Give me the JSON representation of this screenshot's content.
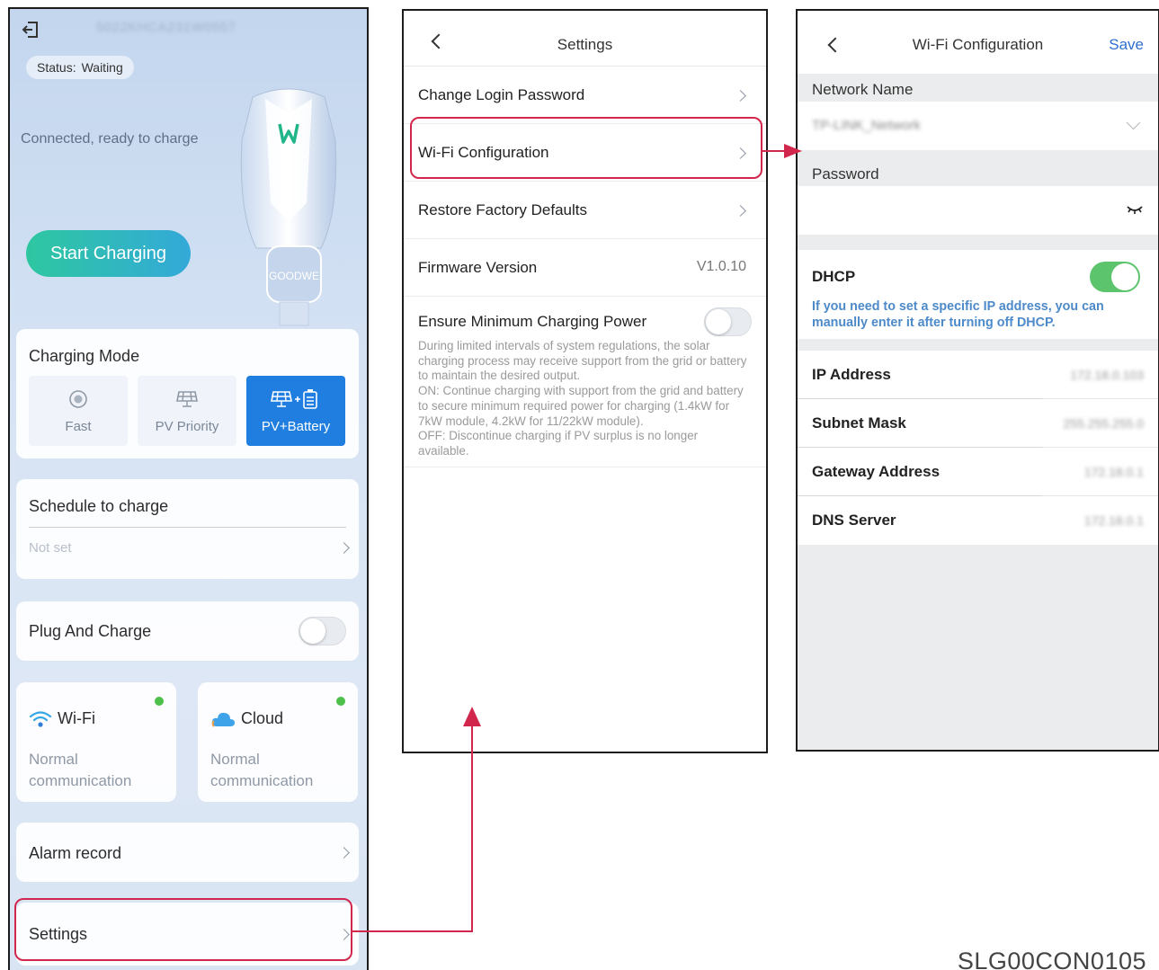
{
  "home": {
    "device_sn": "5022KHCA231W0557",
    "status_label": "Status:",
    "status_value": "Waiting",
    "connection_text": "Connected, ready to charge",
    "start_button": "Start Charging",
    "charger_brand": "GOODWE",
    "charging_mode": {
      "title": "Charging Mode",
      "options": [
        {
          "label": "Fast",
          "selected": false
        },
        {
          "label": "PV Priority",
          "selected": false
        },
        {
          "label": "PV+Battery",
          "selected": true
        }
      ]
    },
    "schedule": {
      "title": "Schedule to charge",
      "value": "Not set"
    },
    "plug_and_charge": {
      "title": "Plug And Charge",
      "enabled": false
    },
    "wifi": {
      "title": "Wi-Fi",
      "status": "Normal communication"
    },
    "cloud": {
      "title": "Cloud",
      "status": "Normal communication"
    },
    "alarm_record": "Alarm record",
    "settings": "Settings"
  },
  "settings_screen": {
    "title": "Settings",
    "items": [
      {
        "label": "Change Login Password"
      },
      {
        "label": "Wi-Fi Configuration"
      },
      {
        "label": "Restore Factory Defaults"
      }
    ],
    "firmware": {
      "label": "Firmware Version",
      "value": "V1.0.10"
    },
    "min_power": {
      "label": "Ensure Minimum Charging Power",
      "enabled": false,
      "description": "During limited intervals of system regulations, the solar charging process may receive support from the grid or battery to maintain the desired output.\nON: Continue charging with support from the grid and battery to secure minimum required power for charging (1.4kW for 7kW module, 4.2kW for 11/22kW module).\nOFF:  Discontinue charging if PV surplus is no longer available."
    }
  },
  "wifi_screen": {
    "title": "Wi-Fi Configuration",
    "save": "Save",
    "network_name_label": "Network Name",
    "network_name_value": "TP-LINK_Network",
    "password_label": "Password",
    "dhcp": {
      "label": "DHCP",
      "enabled": true,
      "hint": "If you need to set a specific IP address, you can manually enter it after turning off DHCP."
    },
    "fields": [
      {
        "label": "IP Address",
        "value": "172.18.0.103"
      },
      {
        "label": "Subnet Mask",
        "value": "255.255.255.0"
      },
      {
        "label": "Gateway Address",
        "value": "172.18.0.1"
      },
      {
        "label": "DNS Server",
        "value": "172.18.0.1"
      }
    ]
  },
  "colors": {
    "accent_blue": "#1f7ee0",
    "highlight_red": "#d2274c",
    "toggle_green": "#5cc46d",
    "save_blue": "#2f6fd1",
    "status_dot": "#4cc04a"
  },
  "icons": [
    "exit-icon",
    "charger-illustration",
    "fast-charge-icon",
    "pv-panel-icon",
    "pv-battery-icon",
    "wifi-icon",
    "cloud-icon",
    "chevron-right-icon",
    "back-icon",
    "chevron-down-icon",
    "eye-closed-icon"
  ],
  "doc_code": "SLG00CON0105"
}
